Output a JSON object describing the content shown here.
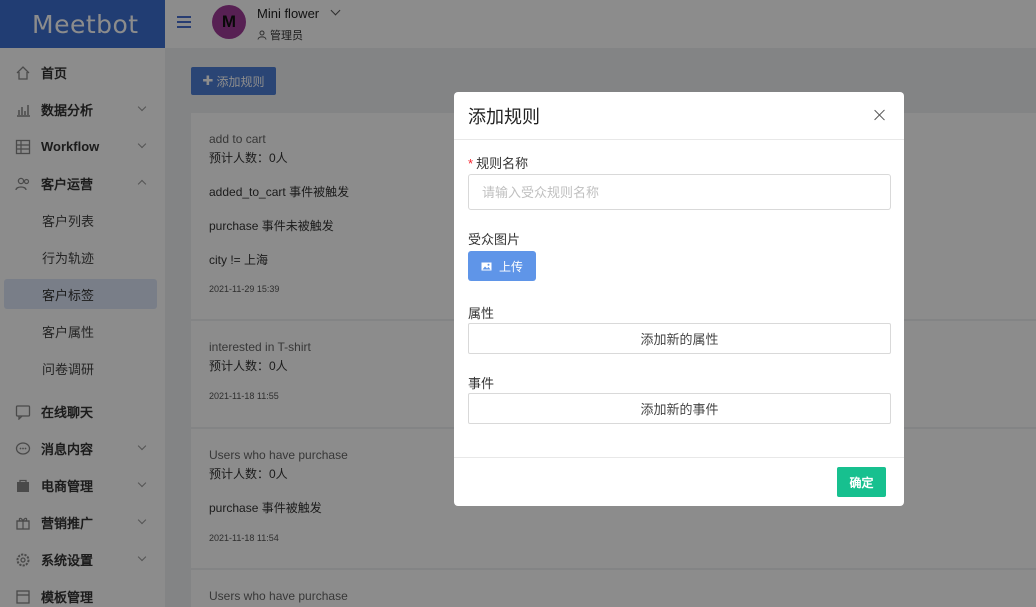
{
  "brand": {
    "logo": "Meetbot"
  },
  "user": {
    "initial": "M",
    "name": "Mini flower",
    "role": "管理员"
  },
  "sidebar": {
    "items": [
      {
        "label": "首页"
      },
      {
        "label": "数据分析"
      },
      {
        "label": "Workflow"
      },
      {
        "label": "客户运营"
      },
      {
        "label": "在线聊天"
      },
      {
        "label": "消息内容"
      },
      {
        "label": "电商管理"
      },
      {
        "label": "营销推广"
      },
      {
        "label": "系统设置"
      },
      {
        "label": "模板管理"
      }
    ],
    "subitems": [
      {
        "label": "客户列表"
      },
      {
        "label": "行为轨迹"
      },
      {
        "label": "客户标签"
      },
      {
        "label": "客户属性"
      },
      {
        "label": "问卷调研"
      }
    ]
  },
  "toolbar": {
    "add_rule": "添加规则"
  },
  "cards": [
    {
      "title": "add to cart",
      "count": "预计人数：0人",
      "lines": [
        "added_to_cart 事件被触发",
        "purchase 事件未被触发",
        "city != 上海"
      ],
      "date": "2021-11-29 15:39"
    },
    {
      "title": "interested in T-shirt",
      "count": "预计人数：0人",
      "date": "2021-11-18 11:55"
    },
    {
      "title": "Users who have purchase",
      "count": "预计人数：0人",
      "lines": [
        "purchase 事件被触发"
      ],
      "date": "2021-11-18 11:54"
    },
    {
      "title": "Users who have purchase"
    }
  ],
  "modal": {
    "title": "添加规则",
    "name_label": "规则名称",
    "name_placeholder": "请输入受众规则名称",
    "image_label": "受众图片",
    "upload": "上传",
    "attr_label": "属性",
    "attr_button": "添加新的属性",
    "event_label": "事件",
    "event_button": "添加新的事件",
    "confirm": "确定"
  },
  "colors": {
    "brand": "#3d6fd1",
    "primary": "#4d7ed6",
    "confirm": "#17c08f",
    "avatar": "#9f3b97"
  }
}
